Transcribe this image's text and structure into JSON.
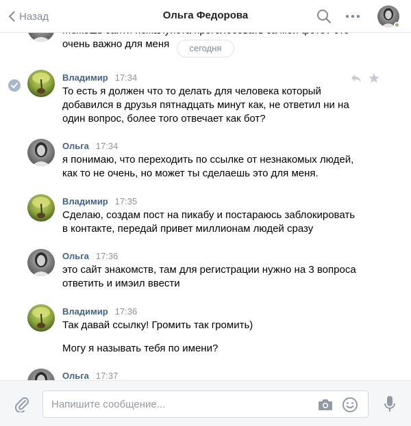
{
  "header": {
    "back_label": "Назад",
    "title": "Ольга Федорова"
  },
  "chat": {
    "date_separator": "сегодня",
    "partial_top": "Можешь зайти пожалуйста проголосовать за мои фото? это очень важно для меня",
    "messages": [
      {
        "author": "Владимир",
        "time": "17:34",
        "lines": [
          "То есть я должен что то делать для человека который",
          "добавился в друзья пятнадцать минут как, не ответил ни на",
          "один вопрос, более того отвечает как бот?"
        ]
      },
      {
        "author": "Ольга",
        "time": "17:34",
        "lines": [
          "я понимаю, что переходить по ссылке от незнакомых людей,",
          "как то не очень, но может ты сделаешь это для меня."
        ]
      },
      {
        "author": "Владимир",
        "time": "17:35",
        "lines": [
          "Сделаю, создам пост на пикабу и постараюсь заблокировать",
          "в контакте, передай привет миллионам людей сразу"
        ]
      },
      {
        "author": "Ольга",
        "time": "17:36",
        "lines": [
          "это сайт знакомств, там для регистрации нужно на 3 вопроса",
          "ответить и имэил ввести"
        ]
      },
      {
        "author": "Владимир",
        "time": "17:36",
        "lines": [
          "Так давай ссылку! Громить так громить)",
          "Могу я называть тебя по имени?"
        ]
      },
      {
        "author": "Ольга",
        "time": "17:37"
      }
    ]
  },
  "compose": {
    "placeholder": "Напишите сообщение..."
  },
  "colors": {
    "author": "#42648b",
    "meta_gray": "#939393",
    "icon_gray": "#828a99",
    "online": "#8ac176"
  }
}
